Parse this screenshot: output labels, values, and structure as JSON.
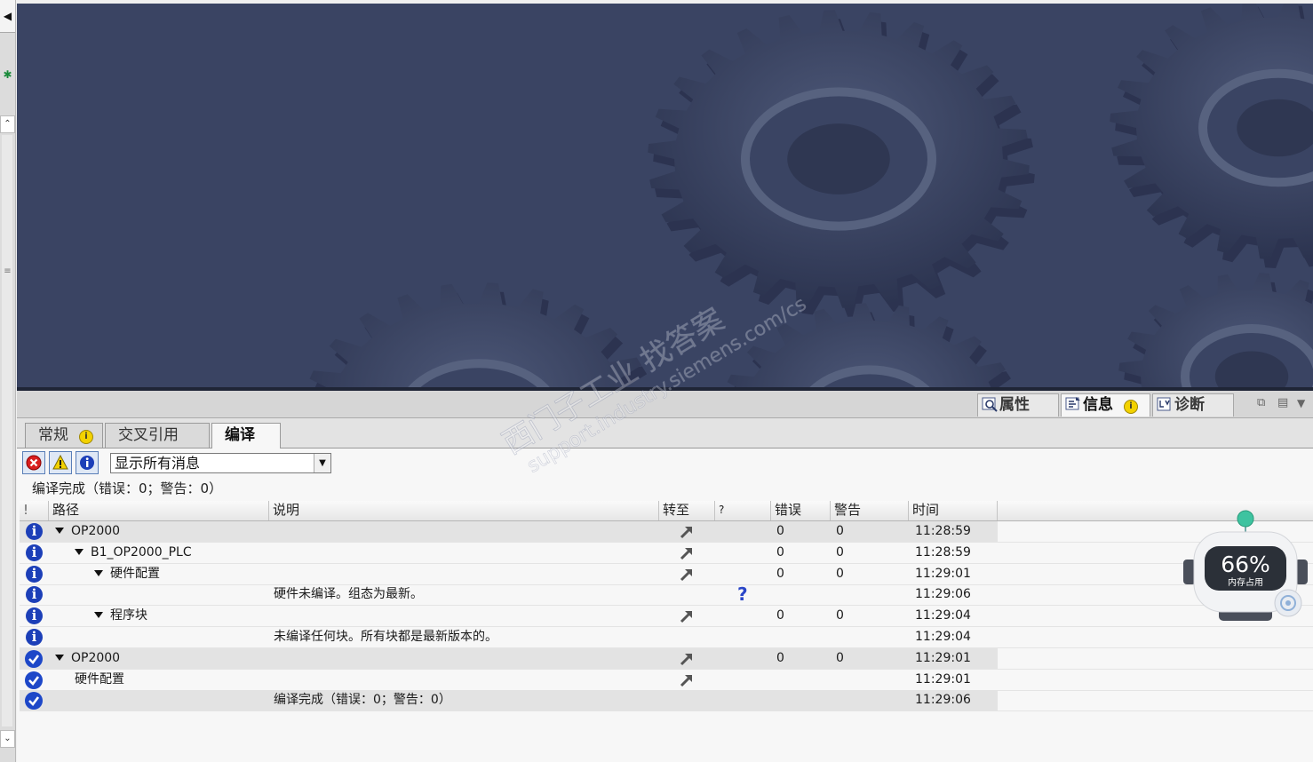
{
  "inspector": {
    "tabs": [
      {
        "label": "属性",
        "icon": "properties-icon"
      },
      {
        "label": "信息",
        "icon": "info-icon",
        "badge": "i"
      },
      {
        "label": "诊断",
        "icon": "diagnostics-icon"
      }
    ]
  },
  "subtabs": [
    {
      "label": "常规",
      "badge": "i"
    },
    {
      "label": "交叉引用"
    },
    {
      "label": "编译",
      "active": true
    }
  ],
  "filter": {
    "select_value": "显示所有消息",
    "buttons": [
      "error-filter-icon",
      "warning-filter-icon",
      "info-filter-icon"
    ]
  },
  "summary": "编译完成（错误：0；警告：0）",
  "table": {
    "columns": [
      "!",
      "路径",
      "说明",
      "转至",
      "?",
      "错误",
      "警告",
      "时间"
    ],
    "rows": [
      {
        "icon": "info",
        "expand": true,
        "path": "OP2000",
        "desc": "",
        "goto": true,
        "help": false,
        "errors": "0",
        "warnings": "0",
        "time": "11:28:59",
        "shaded": true
      },
      {
        "icon": "info",
        "expand": true,
        "path": "B1_OP2000_PLC",
        "desc": "",
        "goto": true,
        "help": false,
        "errors": "0",
        "warnings": "0",
        "time": "11:28:59",
        "shaded": false
      },
      {
        "icon": "info",
        "expand": true,
        "path": "硬件配置",
        "desc": "",
        "goto": true,
        "help": false,
        "errors": "0",
        "warnings": "0",
        "time": "11:29:01",
        "shaded": false
      },
      {
        "icon": "info",
        "expand": false,
        "path": "",
        "desc": "硬件未编译。组态为最新。",
        "goto": false,
        "help": true,
        "errors": "",
        "warnings": "",
        "time": "11:29:06",
        "shaded": false
      },
      {
        "icon": "info",
        "expand": true,
        "path": "程序块",
        "desc": "",
        "goto": true,
        "help": false,
        "errors": "0",
        "warnings": "0",
        "time": "11:29:04",
        "shaded": false
      },
      {
        "icon": "info",
        "expand": false,
        "path": "",
        "desc": "未编译任何块。所有块都是最新版本的。",
        "goto": false,
        "help": false,
        "errors": "",
        "warnings": "",
        "time": "11:29:04",
        "shaded": false
      },
      {
        "icon": "ok",
        "expand": true,
        "path": "OP2000",
        "desc": "",
        "goto": true,
        "help": false,
        "errors": "0",
        "warnings": "0",
        "time": "11:29:01",
        "shaded": true
      },
      {
        "icon": "ok",
        "expand": false,
        "path": "硬件配置",
        "desc": "",
        "goto": true,
        "help": false,
        "errors": "",
        "warnings": "",
        "time": "11:29:01",
        "shaded": false
      },
      {
        "icon": "ok",
        "expand": false,
        "path": "",
        "desc": "编译完成（错误：0；警告：0）",
        "goto": false,
        "help": false,
        "errors": "",
        "warnings": "",
        "time": "11:29:06",
        "shaded": true
      }
    ]
  },
  "watermark": {
    "line1": "西门子工业  找答案",
    "line2": "support.industry.siemens.com/cs"
  },
  "memory": {
    "percent": "66%",
    "label": "内存占用"
  },
  "colors": {
    "workspace_bg": "#3a4463",
    "info_blue": "#1c3fb8",
    "badge_yellow": "#f3d200"
  }
}
